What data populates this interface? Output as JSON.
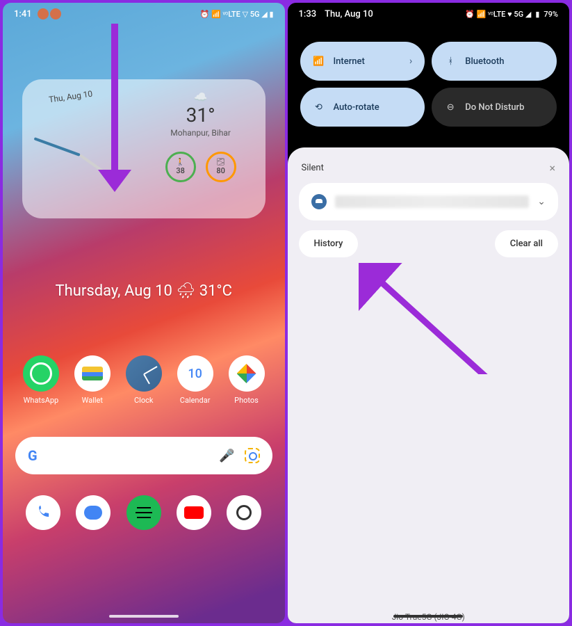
{
  "left": {
    "status": {
      "time": "1:41",
      "icons": "⏰ 📶 ᵛᵒLTE ▽ 5G ◢ ▮"
    },
    "widget": {
      "date": "Thu, Aug 10",
      "temp": "31°",
      "location": "Mohanpur, Bihar",
      "steps": "38",
      "air": "80"
    },
    "dateline": "Thursday, Aug 10 🌧 31°C",
    "apps": [
      {
        "name": "WhatsApp"
      },
      {
        "name": "Wallet"
      },
      {
        "name": "Clock"
      },
      {
        "name": "Calendar"
      },
      {
        "name": "Photos"
      }
    ]
  },
  "right": {
    "status": {
      "time": "1:33",
      "date": "Thu, Aug 10",
      "battery": "79%",
      "icons": "⏰ 📶 ᵛᵒLTE ♥ 5G ◢"
    },
    "tiles": {
      "internet": "Internet",
      "bluetooth": "Bluetooth",
      "autorotate": "Auto-rotate",
      "dnd": "Do Not Disturb"
    },
    "silent_label": "Silent",
    "history_btn": "History",
    "clear_btn": "Clear all",
    "carrier": "Jio True5G (JIO 4G)"
  }
}
